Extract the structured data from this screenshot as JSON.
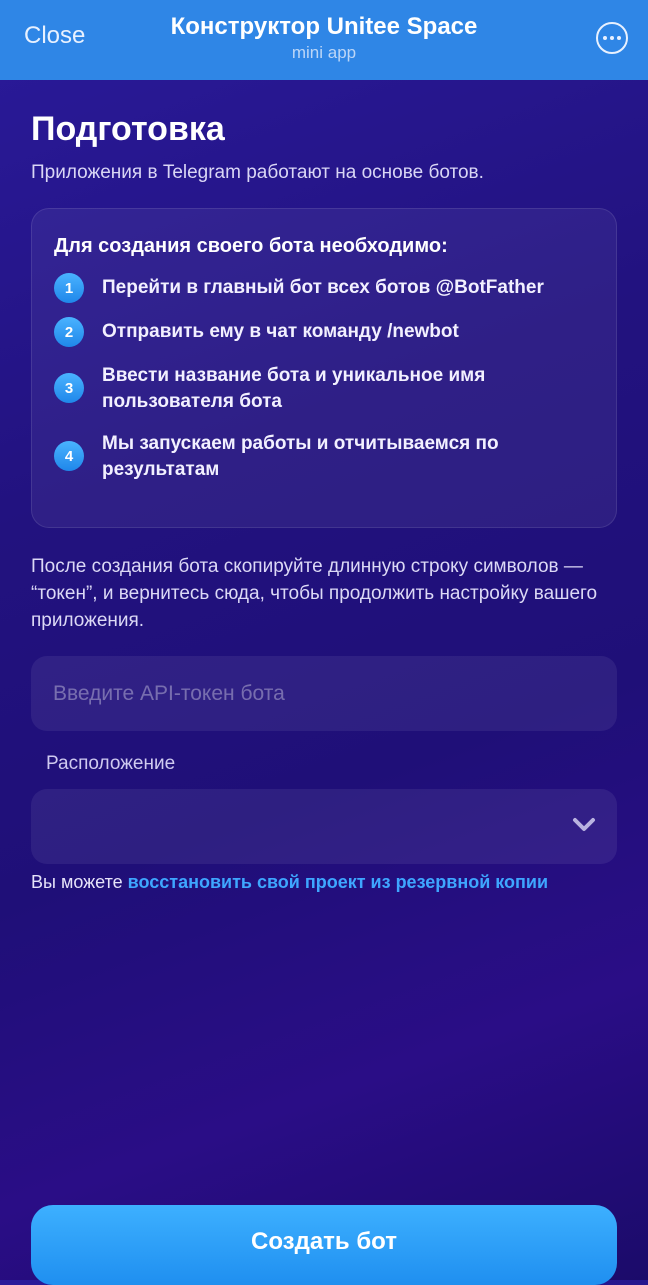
{
  "header": {
    "close_label": "Close",
    "title": "Конструктор Unitee Space",
    "subtitle": "mini app",
    "more_icon": "more-horizontal-icon"
  },
  "main": {
    "title": "Подготовка",
    "intro": "Приложения в Telegram работают на основе ботов.",
    "steps_card": {
      "title": "Для создания своего бота необходимо:",
      "steps": [
        {
          "num": "1",
          "text": "Перейти в главный бот всех ботов @BotFather"
        },
        {
          "num": "2",
          "text": "Отправить ему в чат команду /newbot"
        },
        {
          "num": "3",
          "text": "Ввести название бота и уникальное имя пользователя бота"
        },
        {
          "num": "4",
          "text": "Мы запускаем работы и отчитываемся по результатам"
        }
      ]
    },
    "after_text": "После создания бота скопируйте длинную строку символов — “токен”, и вернитесь сюда, чтобы продолжить настройку вашего приложения.",
    "token_input": {
      "placeholder": "Введите API-токен бота",
      "value": ""
    },
    "location": {
      "label": "Расположение",
      "value": ""
    },
    "restore": {
      "prefix": "Вы можете ",
      "link": "восстановить свой проект из резервной копии"
    }
  },
  "footer": {
    "create_label": "Создать бот"
  },
  "colors": {
    "accent": "#2f86e6",
    "link": "#3ea6ff",
    "button": "#1f8ff0"
  }
}
